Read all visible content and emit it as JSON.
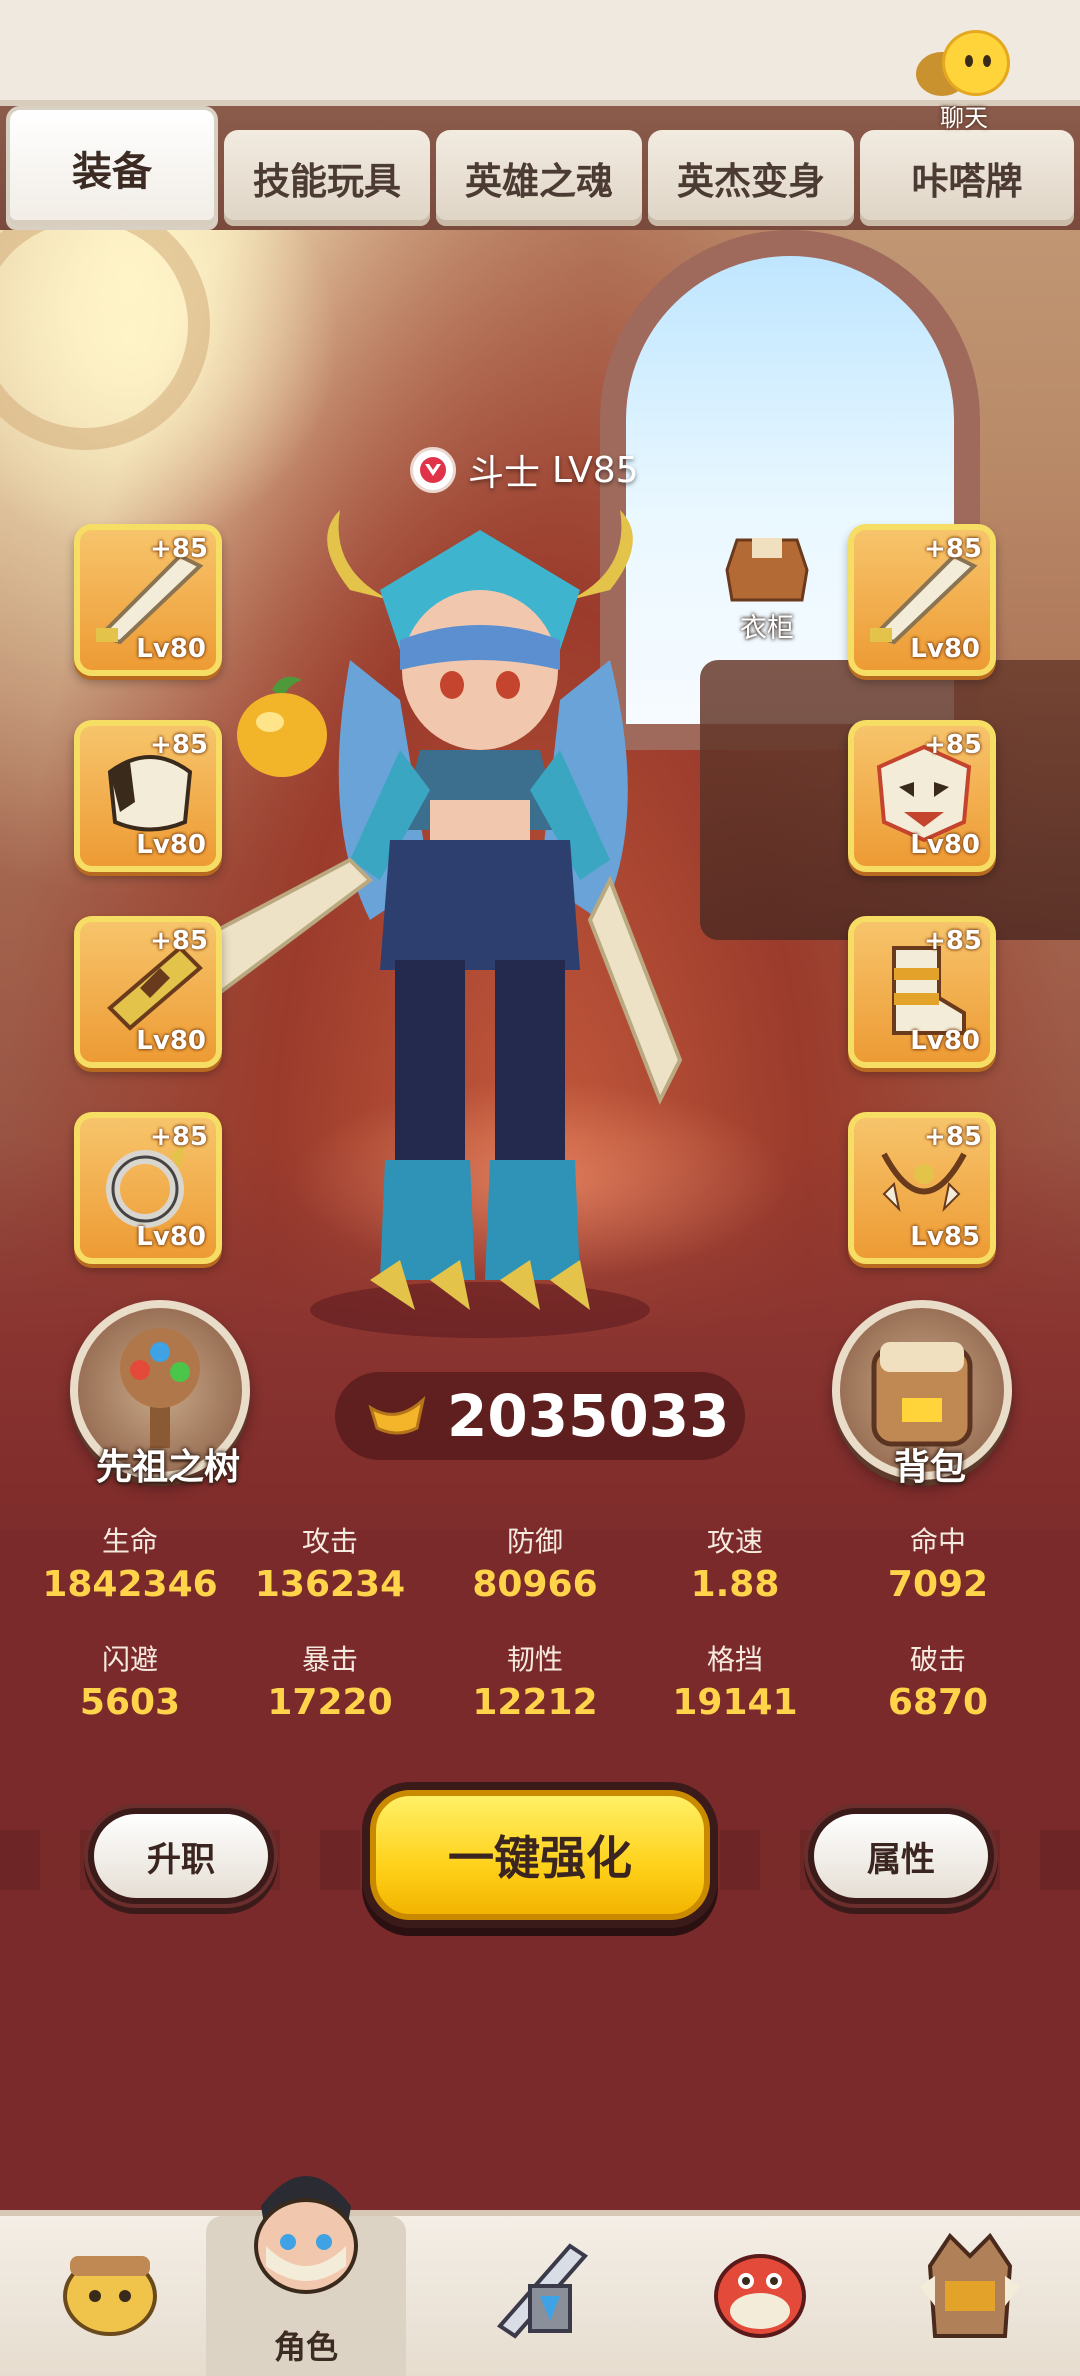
{
  "chat": {
    "label": "聊天"
  },
  "tabs": [
    {
      "label": "装备",
      "active": true
    },
    {
      "label": "技能玩具",
      "active": false
    },
    {
      "label": "英雄之魂",
      "active": false
    },
    {
      "label": "英杰变身",
      "active": false
    },
    {
      "label": "咔嗒牌",
      "active": false
    }
  ],
  "hero": {
    "class_name": "斗士",
    "level": "LV85"
  },
  "wardrobe": {
    "label": "衣柜"
  },
  "equipment_left": [
    {
      "icon": "bone-sword-icon",
      "plus": "+85",
      "level": "Lv80"
    },
    {
      "icon": "horn-helmet-icon",
      "plus": "+85",
      "level": "Lv80"
    },
    {
      "icon": "bracer-icon",
      "plus": "+85",
      "level": "Lv80"
    },
    {
      "icon": "ring-icon",
      "plus": "+85",
      "level": "Lv80"
    }
  ],
  "equipment_right": [
    {
      "icon": "bone-sword-icon",
      "plus": "+85",
      "level": "Lv80"
    },
    {
      "icon": "tiger-mask-icon",
      "plus": "+85",
      "level": "Lv80"
    },
    {
      "icon": "fur-boots-icon",
      "plus": "+85",
      "level": "Lv80"
    },
    {
      "icon": "fang-necklace-icon",
      "plus": "+85",
      "level": "Lv85"
    }
  ],
  "ancestor_tree": {
    "label": "先祖之树"
  },
  "backpack": {
    "label": "背包"
  },
  "gold": {
    "value": "2035033"
  },
  "stats": [
    {
      "name": "生命",
      "value": "1842346"
    },
    {
      "name": "攻击",
      "value": "136234"
    },
    {
      "name": "防御",
      "value": "80966"
    },
    {
      "name": "攻速",
      "value": "1.88"
    },
    {
      "name": "命中",
      "value": "7092"
    },
    {
      "name": "闪避",
      "value": "5603"
    },
    {
      "name": "暴击",
      "value": "17220"
    },
    {
      "name": "韧性",
      "value": "12212"
    },
    {
      "name": "格挡",
      "value": "19141"
    },
    {
      "name": "破击",
      "value": "6870"
    }
  ],
  "actions": {
    "promote": "升职",
    "one_key_enhance": "一键强化",
    "attributes": "属性"
  },
  "bottom_nav": [
    {
      "label": "",
      "icon": "pet-icon"
    },
    {
      "label": "角色",
      "icon": "character-icon",
      "active": true
    },
    {
      "label": "",
      "icon": "battle-icon"
    },
    {
      "label": "",
      "icon": "dino-icon"
    },
    {
      "label": "",
      "icon": "totem-icon"
    }
  ],
  "colors": {
    "accent": "#ffd34a",
    "slot": "#ed9b34",
    "panel": "#7a2a2a"
  }
}
